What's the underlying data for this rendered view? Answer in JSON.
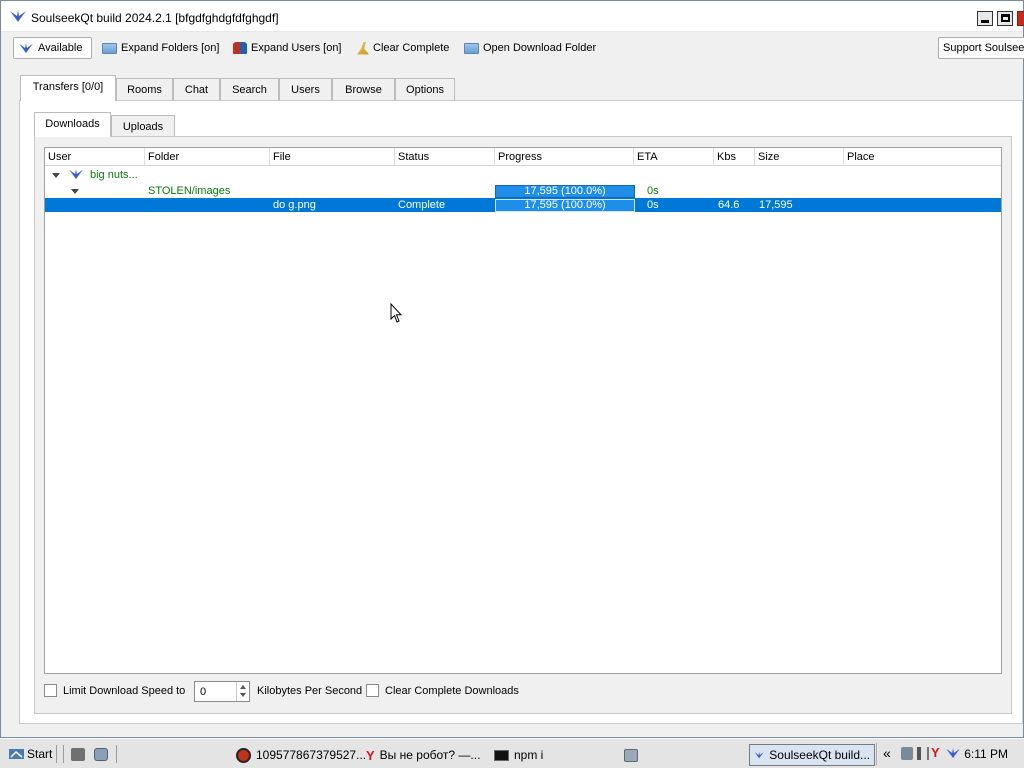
{
  "window": {
    "title": "SoulseekQt build 2024.2.1 [bfgdfghdgfdfghgdf]"
  },
  "toolbar": {
    "available": "Available",
    "expand_folders": "Expand Folders [on]",
    "expand_users": "Expand Users [on]",
    "clear_complete": "Clear Complete",
    "open_download_folder": "Open Download Folder",
    "support": "Support Soulseek"
  },
  "tabs": [
    "Transfers [0/0]",
    "Rooms",
    "Chat",
    "Search",
    "Users",
    "Browse",
    "Options"
  ],
  "subtabs": [
    "Downloads",
    "Uploads"
  ],
  "columns": [
    "User",
    "Folder",
    "File",
    "Status",
    "Progress",
    "ETA",
    "Kbs",
    "Size",
    "Place"
  ],
  "transfers": {
    "user": "big nuts...",
    "folder": "STOLEN/images",
    "folder_progress": "17,595 (100.0%)",
    "folder_eta": "0s",
    "file": {
      "name": "do g.png",
      "status": "Complete",
      "progress": "17,595 (100.0%)",
      "progress_fraction": 1.0,
      "eta": "0s",
      "kbs": "64.6",
      "size": "17,595",
      "place": ""
    }
  },
  "bottom": {
    "limit_label": "Limit Download Speed to",
    "limit_value": "0",
    "unit": "Kilobytes Per Second",
    "clear_label": "Clear Complete Downloads"
  },
  "taskbar": {
    "start": "Start",
    "tasks": [
      "109577867379527...",
      "Вы не робот? —...",
      "npm i",
      "SoulseekQt build..."
    ],
    "clock": "6:11 PM",
    "tray_chevron": "«"
  },
  "colors": {
    "selection": "#0078d7",
    "progress": "#1e8ee8",
    "folder_text": "#0a7a0a",
    "close_button": "#c42b1c"
  },
  "icons": [
    "soulseek-bird-icon",
    "folder-icon",
    "users-icon",
    "broom-icon",
    "minimize-icon",
    "maximize-icon",
    "close-icon"
  ]
}
